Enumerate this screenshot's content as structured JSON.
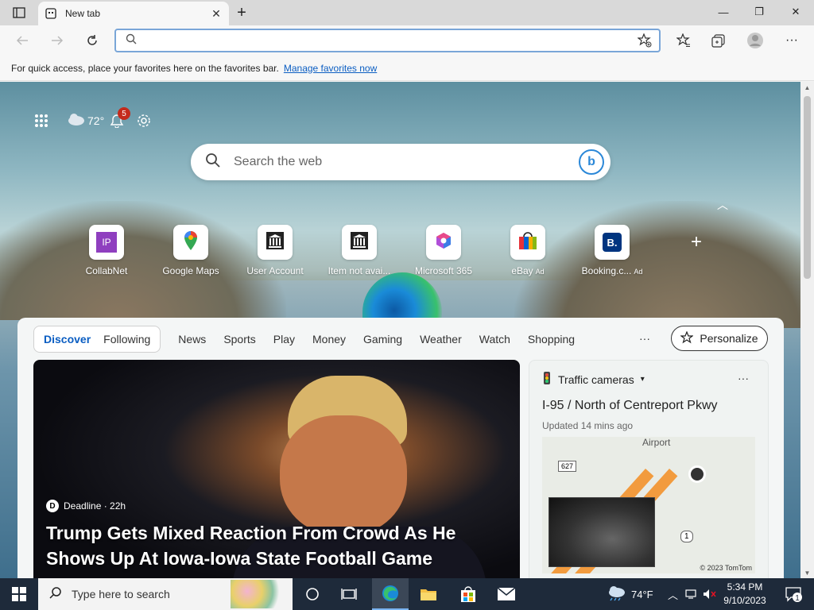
{
  "browser": {
    "tab_title": "New tab",
    "address_value": "",
    "favorites_bar_text": "For quick access, place your favorites here on the favorites bar.",
    "favorites_bar_link": "Manage favorites now"
  },
  "newtab": {
    "weather_temp": "72°",
    "notification_count": "5",
    "search_placeholder": "Search the web",
    "quick_links": [
      {
        "label": "CollabNet",
        "ad": ""
      },
      {
        "label": "Google Maps",
        "ad": ""
      },
      {
        "label": "User Account",
        "ad": ""
      },
      {
        "label": "Item not avai...",
        "ad": ""
      },
      {
        "label": "Microsoft 365",
        "ad": ""
      },
      {
        "label": "eBay",
        "ad": "Ad"
      },
      {
        "label": "Booking.c...",
        "ad": "Ad"
      }
    ],
    "feed_tabs": {
      "active": "Discover",
      "following": "Following",
      "items": [
        "News",
        "Sports",
        "Play",
        "Money",
        "Gaming",
        "Weather",
        "Watch",
        "Shopping"
      ],
      "more": "···",
      "personalize": "Personalize"
    },
    "hero": {
      "source": "Deadline · 22h",
      "source_initial": "D",
      "headline": "Trump Gets Mixed Reaction From Crowd As He Shows Up At Iowa-Iowa State Football Game"
    },
    "traffic": {
      "header": "Traffic cameras",
      "more": "···",
      "location": "I-95 / North of Centreport Pkwy",
      "updated": "Updated 14 mins ago",
      "map_label": "Airport",
      "shield_1": "627",
      "shield_2": "1",
      "copyright": "© 2023 TomTom"
    }
  },
  "taskbar": {
    "search_placeholder": "Type here to search",
    "weather": "74°F",
    "time": "5:34 PM",
    "date": "9/10/2023",
    "notifications": "1"
  }
}
